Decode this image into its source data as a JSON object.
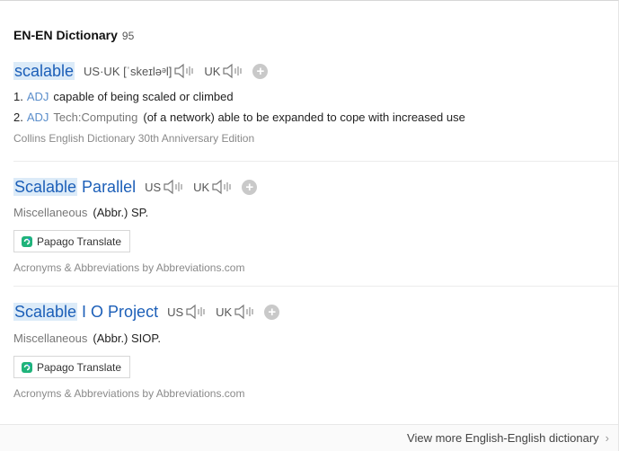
{
  "header": {
    "title": "EN-EN Dictionary",
    "count": "95"
  },
  "entries": [
    {
      "word": "scalable",
      "pron_us_uk": "US·UK [ˈskeɪləᵊl]",
      "uk": "UK",
      "senses": [
        {
          "num": "1.",
          "pos": "ADJ",
          "field": "",
          "text": "capable of being scaled or climbed"
        },
        {
          "num": "2.",
          "pos": "ADJ",
          "field": "Tech:Computing",
          "text": "(of a network) able to be expanded to cope with increased use"
        }
      ],
      "source": "Collins English Dictionary 30th Anniversary Edition"
    },
    {
      "word_hl": "Scalable",
      "word_rest": " Parallel",
      "us": "US",
      "uk": "UK",
      "category": "Miscellaneous",
      "definition": "(Abbr.) SP.",
      "papago": "Papago Translate",
      "source": "Acronyms & Abbreviations by Abbreviations.com"
    },
    {
      "word_hl": "Scalable",
      "word_rest": " I O Project",
      "us": "US",
      "uk": "UK",
      "category": "Miscellaneous",
      "definition": "(Abbr.) SIOP.",
      "papago": "Papago Translate",
      "source": "Acronyms & Abbreviations by Abbreviations.com"
    }
  ],
  "footer": {
    "more_label": "View more English-English dictionary",
    "chevron": "›"
  },
  "icons": {
    "speaker": "speaker-icon",
    "add": "plus-icon",
    "papago": "papago-icon",
    "chevron": "chevron-right-icon"
  },
  "colors": {
    "link": "#1c5fb8",
    "pos": "#5b8ecb",
    "highlight": "#dcebf8"
  }
}
